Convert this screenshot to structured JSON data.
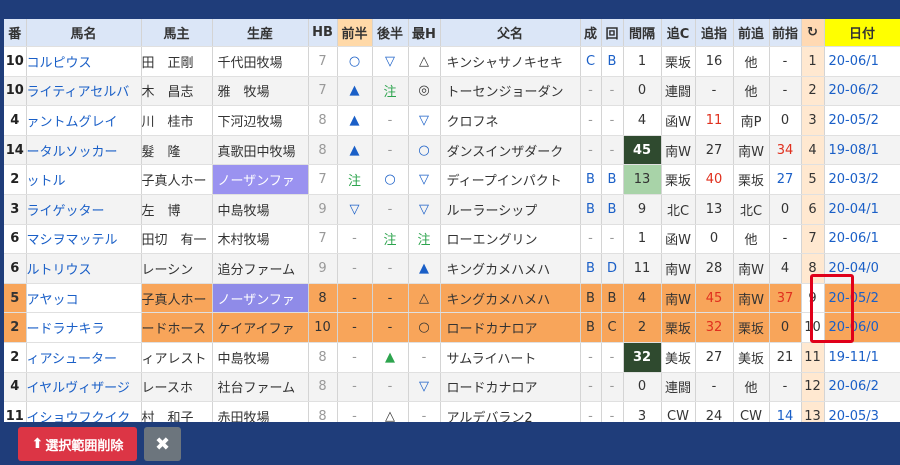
{
  "headers": [
    "番",
    "馬名",
    "馬主",
    "生産",
    "HB",
    "前半",
    "後半",
    "最H",
    "父名",
    "成",
    "回",
    "間隔",
    "追C",
    "追指",
    "前追",
    "前指",
    "C",
    "日付"
  ],
  "rows": [
    {
      "num": "10",
      "name": "コルピウス",
      "owner": "田　正剛",
      "producer": "千代田牧場",
      "hb": "7",
      "zh": "○",
      "kh": "▽",
      "sh": "△",
      "sire": "キンシャサノキセキ",
      "sei": "C",
      "kai": "B",
      "kankaku": "1",
      "oic": "栗坂",
      "oishi": "16",
      "zenoi": "他",
      "zenshi": "-",
      "c": "1",
      "date": "20-06/1"
    },
    {
      "num": "10",
      "name": "ライティアセルバ",
      "owner": "木　昌志",
      "producer": "雅　牧場",
      "hb": "7",
      "zh": "▲",
      "kh": "注",
      "sh": "◎",
      "sire": "トーセンジョーダン",
      "sei": "-",
      "kai": "-",
      "kankaku": "0",
      "oic": "連闘",
      "oishi": "-",
      "zenoi": "他",
      "zenshi": "-",
      "c": "2",
      "date": "20-06/2"
    },
    {
      "num": "4",
      "name": "ァントムグレイ",
      "owner": "川　桂市",
      "producer": "下河辺牧場",
      "hb": "8",
      "zh": "▲",
      "kh": "-",
      "sh": "▽",
      "sire": "クロフネ",
      "sei": "-",
      "kai": "-",
      "kankaku": "4",
      "oic": "函W",
      "oishi": "11",
      "zenoi": "南P",
      "zenshi": "0",
      "c": "3",
      "date": "20-05/2"
    },
    {
      "num": "14",
      "name": "ータルソッカー",
      "owner": "髮　隆",
      "producer": "真歌田中牧場",
      "hb": "8",
      "zh": "▲",
      "kh": "-",
      "sh": "○",
      "sire": "ダンスインザダーク",
      "sei": "-",
      "kai": "-",
      "kankaku": "45",
      "oic": "南W",
      "oishi": "27",
      "zenoi": "南W",
      "zenshi": "34",
      "c": "4",
      "date": "19-08/1"
    },
    {
      "num": "2",
      "name": "ットル",
      "owner": "子真人ホー",
      "producer": "ノーザンファ",
      "hb": "7",
      "zh": "注",
      "kh": "○",
      "sh": "▽",
      "sire": "ディープインパクト",
      "sei": "B",
      "kai": "B",
      "kankaku": "13",
      "oic": "栗坂",
      "oishi": "40",
      "zenoi": "栗坂",
      "zenshi": "27",
      "c": "5",
      "date": "20-03/2"
    },
    {
      "num": "3",
      "name": "ライゲッター",
      "owner": "左　博",
      "producer": "中島牧場",
      "hb": "9",
      "zh": "▽",
      "kh": "-",
      "sh": "▽",
      "sire": "ルーラーシップ",
      "sei": "B",
      "kai": "B",
      "kankaku": "9",
      "oic": "北C",
      "oishi": "13",
      "zenoi": "北C",
      "zenshi": "0",
      "c": "6",
      "date": "20-04/1"
    },
    {
      "num": "6",
      "name": "マシヲマッテル",
      "owner": "田切　有一",
      "producer": "木村牧場",
      "hb": "7",
      "zh": "-",
      "kh": "注",
      "sh": "注",
      "sire": "ローエングリン",
      "sei": "-",
      "kai": "-",
      "kankaku": "1",
      "oic": "函W",
      "oishi": "0",
      "zenoi": "他",
      "zenshi": "-",
      "c": "7",
      "date": "20-06/1"
    },
    {
      "num": "6",
      "name": "ルトリウス",
      "owner": "レーシン",
      "producer": "追分ファーム",
      "hb": "9",
      "zh": "-",
      "kh": "-",
      "sh": "▲",
      "sire": "キングカメハメハ",
      "sei": "B",
      "kai": "D",
      "kankaku": "11",
      "oic": "南W",
      "oishi": "28",
      "zenoi": "南W",
      "zenshi": "4",
      "c": "8",
      "date": "20-04/0"
    },
    {
      "num": "5",
      "name": "アヤッコ",
      "owner": "子真人ホー",
      "producer": "ノーザンファ",
      "hb": "8",
      "zh": "-",
      "kh": "-",
      "sh": "△",
      "sire": "キングカメハメハ",
      "sei": "B",
      "kai": "B",
      "kankaku": "4",
      "oic": "南W",
      "oishi": "45",
      "zenoi": "南W",
      "zenshi": "37",
      "c": "9",
      "date": "20-05/2"
    },
    {
      "num": "2",
      "name": "ードラナキラ",
      "owner": "ードホース",
      "producer": "ケイアイファ",
      "hb": "10",
      "zh": "-",
      "kh": "-",
      "sh": "○",
      "sire": "ロードカナロア",
      "sei": "B",
      "kai": "C",
      "kankaku": "2",
      "oic": "栗坂",
      "oishi": "32",
      "zenoi": "栗坂",
      "zenshi": "0",
      "c": "10",
      "date": "20-06/0"
    },
    {
      "num": "2",
      "name": "ィアシューター",
      "owner": "ィアレスト",
      "producer": "中島牧場",
      "hb": "8",
      "zh": "-",
      "kh": "▲",
      "sh": "-",
      "sire": "サムライハート",
      "sei": "-",
      "kai": "-",
      "kankaku": "32",
      "oic": "美坂",
      "oishi": "27",
      "zenoi": "美坂",
      "zenshi": "21",
      "c": "11",
      "date": "19-11/1"
    },
    {
      "num": "4",
      "name": "イヤルヴィザージ",
      "owner": "レースホ",
      "producer": "社台ファーム",
      "hb": "8",
      "zh": "-",
      "kh": "-",
      "sh": "▽",
      "sire": "ロードカナロア",
      "sei": "-",
      "kai": "-",
      "kankaku": "0",
      "oic": "連闘",
      "oishi": "-",
      "zenoi": "他",
      "zenshi": "-",
      "c": "12",
      "date": "20-06/2"
    },
    {
      "num": "11",
      "name": "イショウフクイク",
      "owner": "村　和子",
      "producer": "赤田牧場",
      "hb": "8",
      "zh": "-",
      "kh": "△",
      "sh": "-",
      "sire": "アルデバラン2",
      "sei": "-",
      "kai": "-",
      "kankaku": "3",
      "oic": "CW",
      "oishi": "24",
      "zenoi": "CW",
      "zenshi": "14",
      "c": "13",
      "date": "20-05/3"
    }
  ],
  "buttons": {
    "delete_label": "選択範囲削除",
    "close_label": "✖"
  }
}
